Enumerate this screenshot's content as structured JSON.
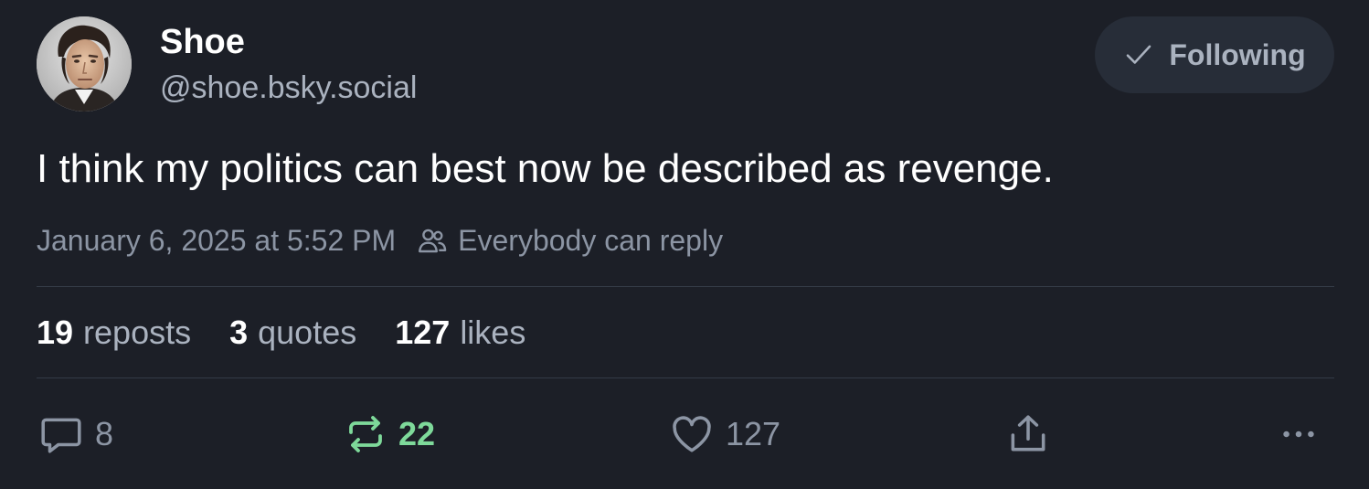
{
  "author": {
    "name": "Shoe",
    "handle": "@shoe.bsky.social"
  },
  "follow_button": {
    "icon": "check-icon",
    "label": "Following"
  },
  "post": {
    "text": "I think my politics can best now be described as revenge.",
    "timestamp": "January 6, 2025 at 5:52 PM",
    "reply_setting_icon": "people-icon",
    "reply_setting": "Everybody can reply"
  },
  "stats": {
    "reposts": {
      "count": "19",
      "label": "reposts"
    },
    "quotes": {
      "count": "3",
      "label": "quotes"
    },
    "likes": {
      "count": "127",
      "label": "likes"
    }
  },
  "actions": {
    "reply": {
      "icon": "comment-icon",
      "count": "8"
    },
    "repost": {
      "icon": "repost-icon",
      "count": "22",
      "active": true
    },
    "like": {
      "icon": "heart-icon",
      "count": "127"
    },
    "share": {
      "icon": "share-icon"
    },
    "more": {
      "icon": "more-icon"
    }
  },
  "colors": {
    "background": "#1c1f27",
    "primary_text": "#ffffff",
    "secondary_text": "#aab2bf",
    "muted_text": "#8c95a4",
    "divider": "#343b47",
    "repost_active": "#7ed99a",
    "button_bg": "#272d38"
  }
}
